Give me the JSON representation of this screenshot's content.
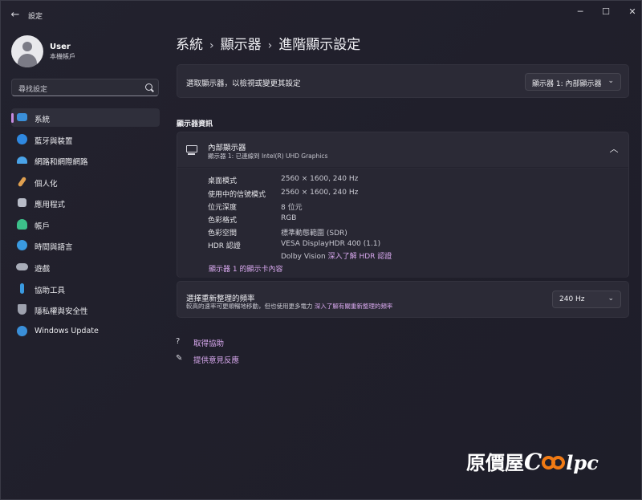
{
  "window": {
    "title": "設定",
    "back_icon": "arrow-left-icon",
    "controls": {
      "minimize": "─",
      "maximize": "☐",
      "close": "✕"
    }
  },
  "profile": {
    "name": "User",
    "account": "本機帳戶"
  },
  "search": {
    "placeholder": "尋找設定"
  },
  "nav": [
    {
      "label": "系統",
      "icon": "monitor-icon",
      "color": "#3a8fd8",
      "active": true
    },
    {
      "label": "藍牙與裝置",
      "icon": "bluetooth-icon",
      "color": "#2f88e0"
    },
    {
      "label": "網路和網際網路",
      "icon": "wifi-icon",
      "color": "#4aa3e8"
    },
    {
      "label": "個人化",
      "icon": "paintbrush-icon",
      "color": "#e0a050"
    },
    {
      "label": "應用程式",
      "icon": "apps-icon",
      "color": "#b8bcc8"
    },
    {
      "label": "帳戶",
      "icon": "person-icon",
      "color": "#3cc08a"
    },
    {
      "label": "時間與語言",
      "icon": "globe-clock-icon",
      "color": "#3a9ae0"
    },
    {
      "label": "遊戲",
      "icon": "gamepad-icon",
      "color": "#a8acb8"
    },
    {
      "label": "協助工具",
      "icon": "accessibility-icon",
      "color": "#3a9ae0"
    },
    {
      "label": "隱私權與安全性",
      "icon": "shield-icon",
      "color": "#9ea2ae"
    },
    {
      "label": "Windows Update",
      "icon": "update-icon",
      "color": "#3a8fd8"
    }
  ],
  "breadcrumb": {
    "part1": "系統",
    "part2": "顯示器",
    "part3": "進階顯示設定",
    "separator": "›"
  },
  "select_display": {
    "label": "選取顯示器，以檢視或變更其設定",
    "value": "顯示器 1: 內部顯示器"
  },
  "section_title": "顯示器資訊",
  "display_info": {
    "title": "內部顯示器",
    "subtitle": "顯示器 1: 已連線到 Intel(R) UHD Graphics",
    "rows": [
      {
        "label": "桌面模式",
        "value": "2560 × 1600, 240 Hz"
      },
      {
        "label": "使用中的信號模式",
        "value": "2560 × 1600, 240 Hz"
      },
      {
        "label": "位元深度",
        "value": "8 位元"
      },
      {
        "label": "色彩格式",
        "value": "RGB"
      },
      {
        "label": "色彩空間",
        "value": "標準動態範圍 (SDR)"
      },
      {
        "label": "HDR 認證",
        "value": "VESA DisplayHDR 400 (1.1)"
      }
    ],
    "hdr_extra_prefix": "Dolby Vision",
    "hdr_link": "深入了解 HDR 認證",
    "adapter_link": "顯示器 1 的顯示卡內容"
  },
  "refresh": {
    "title": "選擇重新整理的頻率",
    "desc": "較高的速率可更順暢地移動，但也使用更多電力",
    "link": "深入了解有關重新整理的頻率",
    "value": "240 Hz"
  },
  "help": {
    "get_help": "取得協助",
    "feedback": "提供意見反應"
  },
  "watermark": {
    "text_cn": "原價屋",
    "text_c": "C",
    "text_rest": "lpc"
  },
  "colors": {
    "accent": "#c58be0",
    "link": "#d9a9ef",
    "background": "#202029",
    "card": "#2b2a36"
  }
}
